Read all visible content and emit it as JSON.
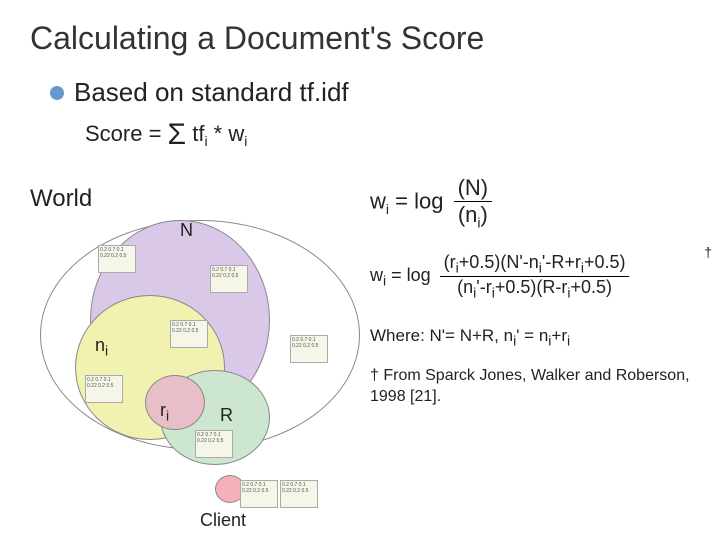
{
  "title": "Calculating a Document's Score",
  "bullet1": "Based on standard tf.idf",
  "score_line_prefix": "Score = ",
  "score_line_suffix": " tf",
  "score_line_sub": "i",
  "score_line_rest": " * w",
  "score_line_sub2": "i",
  "world": "World",
  "labels": {
    "N": "N",
    "ni": "n",
    "ni_sub": "i",
    "ri": "r",
    "ri_sub": "i",
    "R": "R",
    "client": "Client"
  },
  "formula1": {
    "lhs": "w",
    "lhs_sub": "i",
    "mid": " = log ",
    "num": "(N)",
    "den_pre": "(n",
    "den_sub": "i",
    "den_post": ")"
  },
  "formula2": {
    "lhs": "w",
    "lhs_sub": "i",
    "mid": " = log ",
    "num_a": "(r",
    "num_a_sub": "i",
    "num_b": "+0.5)(N'-n",
    "num_b_sub": "i",
    "num_c": "'-R+r",
    "num_c_sub": "i",
    "num_d": "+0.5)",
    "den_a": "(n",
    "den_a_sub": "i",
    "den_b": "'-r",
    "den_b_sub": "i",
    "den_c": "+0.5)(R-r",
    "den_c_sub": "i",
    "den_d": "+0.5)",
    "dagger": "†"
  },
  "where": {
    "pre": "Where: N'= N+R,  n",
    "sub": "i",
    "mid": "' = n",
    "sub2": "i",
    "mid2": "+r",
    "sub3": "i"
  },
  "citation": {
    "dag": "† ",
    "text": "From Sparck Jones, Walker and Roberson, 1998 [21]."
  },
  "minibox_sample": "0.2 0.7\n0.1 0.22\n0.2 0.5"
}
